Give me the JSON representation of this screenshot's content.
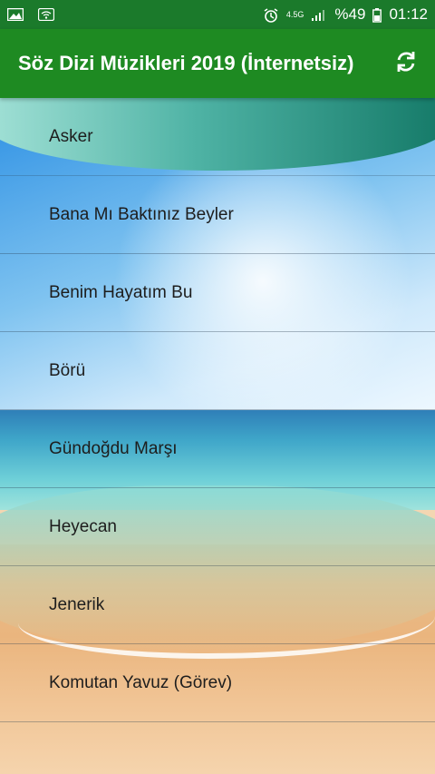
{
  "status_bar": {
    "battery_text": "%49",
    "time": "01:12",
    "network_label": "4.5G",
    "icons": [
      "gallery-icon",
      "wifi-icon",
      "alarm-icon",
      "signal-icon",
      "battery-icon"
    ]
  },
  "toolbar": {
    "title": "Söz Dizi Müzikleri 2019 (İnternetsiz)",
    "refresh_icon": "refresh-icon"
  },
  "songs": [
    "Asker",
    "Bana Mı Baktınız Beyler",
    "Benim Hayatım Bu",
    "Börü",
    "Gündoğdu Marşı",
    "Heyecan",
    "Jenerik",
    "Komutan Yavuz (Görev)"
  ],
  "colors": {
    "status_bar": "#1b7a2b",
    "toolbar": "#1e8a22",
    "text": "#1d1d1d"
  }
}
